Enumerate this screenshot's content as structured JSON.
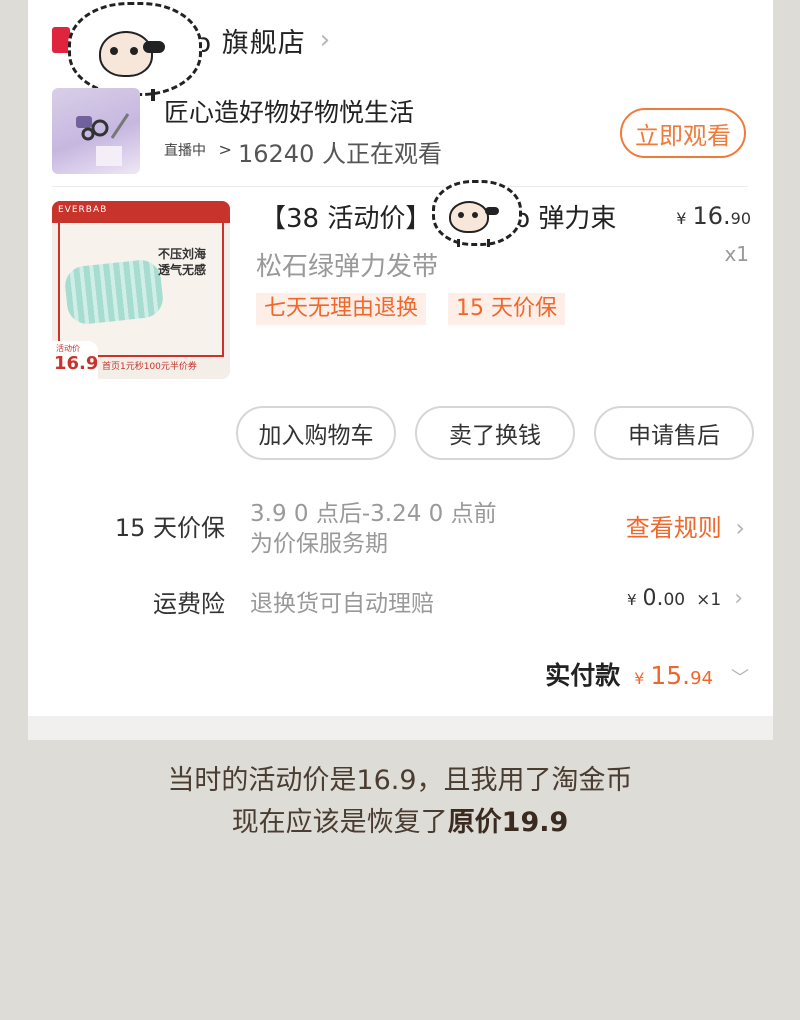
{
  "store": {
    "name": "b 旗舰店"
  },
  "live": {
    "title": "匠心造好物好物悦生活",
    "status_tag": "直播中",
    "status_chevron": ">",
    "viewers_text": "16240 人正在观看",
    "watch_button": "立即观看"
  },
  "product": {
    "title": "【38 活动价】",
    "title_tail": "b 弹力束",
    "subtitle": "松石绿弹力发带",
    "price_symbol": "¥",
    "price_int": "16.",
    "price_dec": "90",
    "quantity": "x1",
    "tags": [
      "七天无理由退换",
      "15 天价保"
    ],
    "image": {
      "brand": "EVERBAB",
      "slogan_line1": "不压刘海",
      "slogan_line2": "透气无感",
      "badge_label": "活动价",
      "badge_price": "16.9",
      "coupon_text": "首页1元秒100元半价券"
    }
  },
  "actions": [
    "加入购物车",
    "卖了换钱",
    "申请售后"
  ],
  "price_protect": {
    "label": "15 天价保",
    "desc_line1": "3.9 0 点后-3.24 0 点前",
    "desc_line2": "为价保服务期",
    "link": "查看规则"
  },
  "shipping_insurance": {
    "label": "运费险",
    "desc": "退换货可自动理赔",
    "price_symbol": "¥",
    "price_int": "0.",
    "price_dec": "00",
    "quantity": "×1"
  },
  "total": {
    "label": "实付款",
    "symbol": "¥",
    "int": "15.",
    "dec": "94"
  },
  "caption": {
    "line1": "当时的活动价是16.9，且我用了淘金币",
    "line2_plain": "现在应该是恢复了",
    "line2_bold": "原价19.9"
  },
  "colors": {
    "accent": "#f0672b",
    "background": "#dedcd7",
    "caption_text": "#4a3c31"
  },
  "icons": [
    "sheep-sticker-icon",
    "chevron-right-icon",
    "chevron-down-icon"
  ]
}
